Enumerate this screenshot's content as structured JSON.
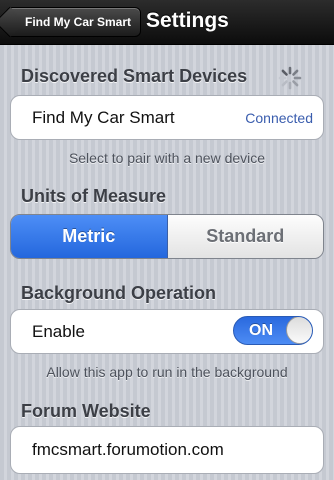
{
  "nav": {
    "back_label": "Find My Car Smart",
    "title": "Settings"
  },
  "devices": {
    "header": "Discovered Smart Devices",
    "device_name": "Find My Car Smart",
    "status": "Connected",
    "footer": "Select to pair with a new device",
    "status_color": "#3a5dae"
  },
  "units": {
    "header": "Units of Measure",
    "options": [
      "Metric",
      "Standard"
    ],
    "selected": "Metric"
  },
  "background": {
    "header": "Background Operation",
    "label": "Enable",
    "toggle_label": "ON",
    "toggle_on": true,
    "footer": "Allow this app to run in the background"
  },
  "forum": {
    "header": "Forum Website",
    "url": "fmcsmart.forumotion.com"
  },
  "colors": {
    "accent": "#2d6ee3",
    "navbar": "#1a1a1a"
  }
}
